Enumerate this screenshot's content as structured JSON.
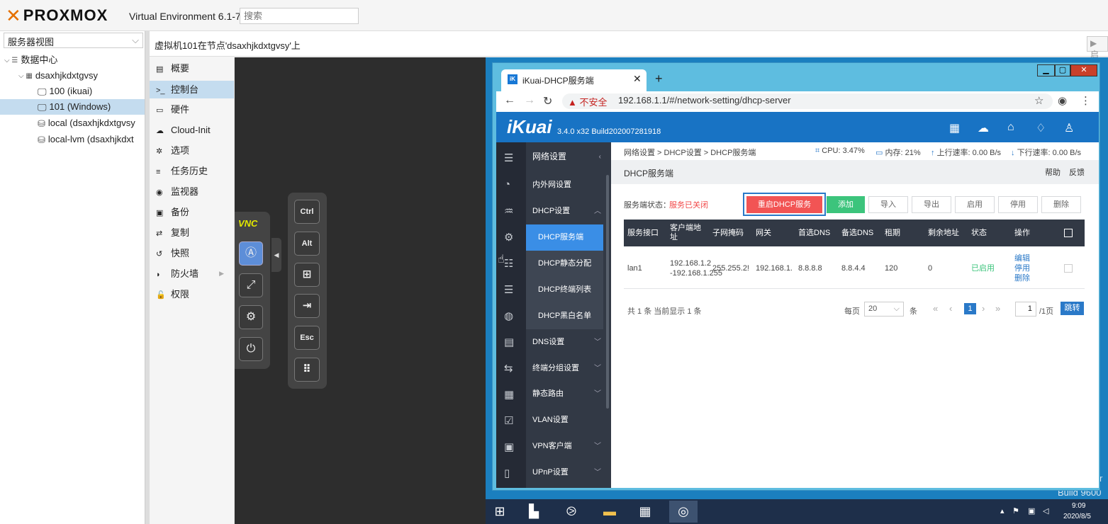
{
  "pve": {
    "logo_text": "PROXMOX",
    "version": "Virtual Environment 6.1-7",
    "search_placeholder": "搜索",
    "view_select": "服务器视图",
    "tree": [
      {
        "label": "数据中心"
      },
      {
        "label": "dsaxhjkdxtgvsy"
      },
      {
        "label": "100 (ikuai)"
      },
      {
        "label": "101 (Windows)"
      },
      {
        "label": "local (dsaxhjkdxtgvsy"
      },
      {
        "label": "local-lvm (dsaxhjkdxt"
      }
    ],
    "vm_title": "虚拟机101在节点'dsaxhjkdxtgvsy'上",
    "start_label": "▶ 启",
    "nav": [
      {
        "icon": "▤",
        "label": "概要"
      },
      {
        "icon": ">_",
        "label": "控制台"
      },
      {
        "icon": "▭",
        "label": "硬件"
      },
      {
        "icon": "☁",
        "label": "Cloud-Init"
      },
      {
        "icon": "✲",
        "label": "选项"
      },
      {
        "icon": "≡",
        "label": "任务历史"
      },
      {
        "icon": "◉",
        "label": "监视器"
      },
      {
        "icon": "▣",
        "label": "备份"
      },
      {
        "icon": "⇄",
        "label": "复制"
      },
      {
        "icon": "↺",
        "label": "快照"
      },
      {
        "icon": "◗",
        "label": "防火墙"
      },
      {
        "icon": "🔓",
        "label": "权限"
      }
    ]
  },
  "vnc": {
    "logo": "VNC",
    "keys": [
      "Ctrl",
      "Alt",
      "⊞",
      "⇥",
      "Esc",
      "⠿"
    ]
  },
  "chrome": {
    "tab_title": "iKuai-DHCP服务端",
    "tab_icon": "iK",
    "insecure": "▲ 不安全",
    "url": "192.168.1.1/#/network-setting/dhcp-server"
  },
  "ikuai": {
    "logo": "iKuai",
    "version": "3.4.0 x32 Build202007281918",
    "breadcrumb": "网络设置 > DHCP设置 > DHCP服务端",
    "cpu": "CPU: 3.47%",
    "mem": "内存: 21%",
    "up": "上行速率: 0.00 B/s",
    "down": "下行速率: 0.00 B/s",
    "page_title": "DHCP服务端",
    "help": "帮助",
    "feedback": "反馈",
    "status_label": "服务端状态：",
    "status_value": "服务已关闭",
    "buttons": {
      "restart": "重启DHCP服务",
      "add": "添加",
      "import": "导入",
      "export": "导出",
      "enable": "启用",
      "disable": "停用",
      "delete": "删除"
    },
    "sidebar": [
      {
        "label": "网络设置"
      },
      {
        "label": "内外网设置"
      },
      {
        "label": "DHCP设置"
      },
      {
        "label": "DHCP服务端"
      },
      {
        "label": "DHCP静态分配"
      },
      {
        "label": "DHCP终端列表"
      },
      {
        "label": "DHCP黑白名单"
      },
      {
        "label": "DNS设置"
      },
      {
        "label": "终端分组设置"
      },
      {
        "label": "静态路由"
      },
      {
        "label": "VLAN设置"
      },
      {
        "label": "VPN客户端"
      },
      {
        "label": "UPnP设置"
      }
    ],
    "columns": [
      "服务接口",
      "客户端地址",
      "子网掩码",
      "网关",
      "首选DNS",
      "备选DNS",
      "租期",
      "剩余地址",
      "状态",
      "操作"
    ],
    "row": {
      "iface": "lan1",
      "client_addr_1": "192.168.1.2",
      "client_addr_2": "-192.168.1.255",
      "mask": "255.255.2!",
      "gateway": "192.168.1.",
      "dns1": "8.8.8.8",
      "dns2": "8.8.4.4",
      "lease": "120",
      "remaining": "0",
      "status": "已启用",
      "op_edit": "编辑",
      "op_disable": "停用",
      "op_delete": "删除"
    },
    "summary": "共 1 条 当前显示 1 条",
    "per_page_label": "每页",
    "per_page_value": "20",
    "per_page_unit": "条",
    "page_current": "1",
    "page_input": "1",
    "page_total": "/1页",
    "jump": "跳转"
  },
  "windows": {
    "time": "9:09",
    "date": "2020/8/5",
    "build_text": "Build 9600",
    "edge_text": "r"
  }
}
